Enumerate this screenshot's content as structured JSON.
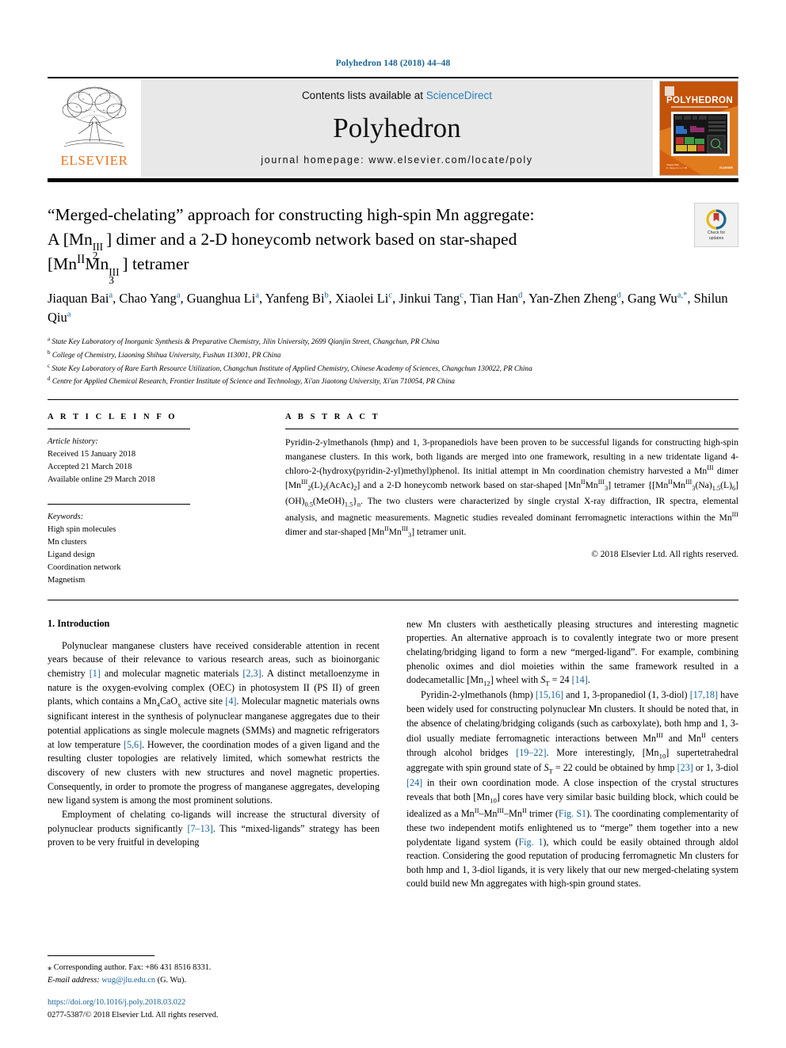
{
  "running_head": "Polyhedron 148 (2018) 44–48",
  "masthead": {
    "contents_prefix": "Contents lists available at ",
    "sciencedirect": "ScienceDirect",
    "journal_name": "Polyhedron",
    "homepage": "journal homepage: www.elsevier.com/locate/poly",
    "publisher_logo_label": "ELSEVIER",
    "cover_title": "POLYHEDRON",
    "cover_subtitle": "THE INTERNATIONAL JOURNAL FOR INORGANIC AND ORGANOMETALLIC CHEMISTRY"
  },
  "crossmark": {
    "line1": "Check for",
    "line2": "updates"
  },
  "title": {
    "line1": "“Merged-chelating” approach for constructing high-spin Mn aggregate:",
    "line2_a": "A [Mn",
    "line2_sub": "2",
    "line2_sup": "III",
    "line2_b": "] dimer and a 2-D honeycomb network based on star-shaped",
    "line3_a": "[Mn",
    "line3_sup1": "II",
    "line3_b": "Mn",
    "line3_sub": "3",
    "line3_sup2": "III",
    "line3_c": "] tetramer"
  },
  "authors": [
    {
      "name": "Jiaquan Bai",
      "sup": "a"
    },
    {
      "name": "Chao Yang",
      "sup": "a"
    },
    {
      "name": "Guanghua Li",
      "sup": "a"
    },
    {
      "name": "Yanfeng Bi",
      "sup": "b"
    },
    {
      "name": "Xiaolei Li",
      "sup": "c"
    },
    {
      "name": "Jinkui Tang",
      "sup": "c"
    },
    {
      "name": "Tian Han",
      "sup": "d"
    },
    {
      "name": "Yan-Zhen Zheng",
      "sup": "d"
    },
    {
      "name": "Gang Wu",
      "sup": "a,*"
    },
    {
      "name": "Shilun Qiu",
      "sup": "a"
    }
  ],
  "affiliations": [
    {
      "mark": "a",
      "text": "State Key Laboratory of Inorganic Synthesis & Preparative Chemistry, Jilin University, 2699 Qianjin Street, Changchun, PR China"
    },
    {
      "mark": "b",
      "text": "College of Chemistry, Liaoning Shihua University, Fushun 113001, PR China"
    },
    {
      "mark": "c",
      "text": "State Key Laboratory of Rare Earth Resource Utilization, Changchun Institute of Applied Chemistry, Chinese Academy of Sciences, Changchun 130022, PR China"
    },
    {
      "mark": "d",
      "text": "Centre for Applied Chemical Research, Frontier Institute of Science and Technology, Xi'an Jiaotong University, Xi'an 710054, PR China"
    }
  ],
  "article_info": {
    "heading": "A R T I C L E   I N F O",
    "history_label": "Article history:",
    "history": [
      "Received 15 January 2018",
      "Accepted 21 March 2018",
      "Available online 29 March 2018"
    ],
    "keywords_label": "Keywords:",
    "keywords": [
      "High spin molecules",
      "Mn clusters",
      "Ligand design",
      "Coordination network",
      "Magnetism"
    ]
  },
  "abstract": {
    "heading": "A B S T R A C T",
    "text": "Pyridin-2-ylmethanols (hmp) and 1, 3-propanediols have been proven to be successful ligands for constructing high-spin manganese clusters. In this work, both ligands are merged into one framework, resulting in a new tridentate ligand 4-chloro-2-(hydroxy(pyridin-2-yl)methyl)phenol. Its initial attempt in Mn coordination chemistry harvested a MnIII dimer [MnIII2(L)2(AcAc)2] and a 2-D honeycomb network based on star-shaped [MnIIMnIII3] tetramer {[MnIIMnIII3(Na)1.5(L)6](OH)0.5(MeOH)1.5}n. The two clusters were characterized by single crystal X-ray diffraction, IR spectra, elemental analysis, and magnetic measurements. Magnetic studies revealed dominant ferromagnetic interactions within the MnIII dimer and star-shaped [MnIIMnIII3] tetramer unit.",
    "copyright": "© 2018 Elsevier Ltd. All rights reserved."
  },
  "body": {
    "intro_heading": "1. Introduction",
    "left_paragraphs": [
      "Polynuclear manganese clusters have received considerable attention in recent years because of their relevance to various research areas, such as bioinorganic chemistry [1] and molecular magnetic materials [2,3]. A distinct metalloenzyme in nature is the oxygen-evolving complex (OEC) in photosystem II (PS II) of green plants, which contains a Mn4CaOx active site [4]. Molecular magnetic materials owns significant interest in the synthesis of polynuclear manganese aggregates due to their potential applications as single molecule magnets (SMMs) and magnetic refrigerators at low temperature [5,6]. However, the coordination modes of a given ligand and the resulting cluster topologies are relatively limited, which somewhat restricts the discovery of new clusters with new structures and novel magnetic properties. Consequently, in order to promote the progress of manganese aggregates, developing new ligand system is among the most prominent solutions.",
      "Employment of chelating co-ligands will increase the structural diversity of polynuclear products significantly [7–13]. This “mixed-ligands” strategy has been proven to be very fruitful in developing"
    ],
    "right_paragraphs": [
      "new Mn clusters with aesthetically pleasing structures and interesting magnetic properties. An alternative approach is to covalently integrate two or more present chelating/bridging ligand to form a new “merged-ligand”. For example, combining phenolic oximes and diol moieties within the same framework resulted in a dodecametallic [Mn12] wheel with ST = 24 [14].",
      "Pyridin-2-ylmethanols (hmp) [15,16] and 1, 3-propanediol (1, 3-diol) [17,18] have been widely used for constructing polynuclear Mn clusters. It should be noted that, in the absence of chelating/bridging coligands (such as carboxylate), both hmp and 1, 3-diol usually mediate ferromagnetic interactions between MnIII and MnII centers through alcohol bridges [19–22]. More interestingly, [Mn10] supertetrahedral aggregate with spin ground state of ST = 22 could be obtained by hmp [23] or 1, 3-diol [24] in their own coordination mode. A close inspection of the crystal structures reveals that both [Mn10] cores have very similar basic building block, which could be idealized as a MnII–MnIII–MnII trimer (Fig. S1). The coordinating complementarity of these two independent motifs enlightened us to “merge” them together into a new polydentate ligand system (Fig. 1), which could be easily obtained through aldol reaction. Considering the good reputation of producing ferromagnetic Mn clusters for both hmp and 1, 3-diol ligands, it is very likely that our new merged-chelating system could build new Mn aggregates with high-spin ground states."
    ]
  },
  "footer": {
    "corresponding_symbol": "⁎",
    "corresponding": "Corresponding author. Fax: +86 431 8516 8331.",
    "email_label": "E-mail address:",
    "email": "wug@jlu.edu.cn",
    "email_owner": "(G. Wu).",
    "doi": "https://doi.org/10.1016/j.poly.2018.03.022",
    "issn": "0277-5387/© 2018 Elsevier Ltd. All rights reserved."
  },
  "colors": {
    "link": "#1a6496",
    "elsevier_orange": "#e87422",
    "masthead_bg": "#e8e8e8"
  }
}
